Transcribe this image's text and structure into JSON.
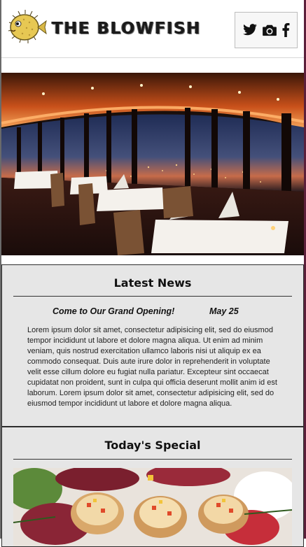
{
  "header": {
    "brand_name": "THE BLOWFISH",
    "social_icons": [
      "twitter-icon",
      "camera-icon",
      "facebook-icon"
    ]
  },
  "news": {
    "heading": "Latest News",
    "item_title": "Come to Our Grand Opening!",
    "item_date": "May 25",
    "body": "Lorem ipsum dolor sit amet, consectetur adipisicing elit, sed do eiusmod tempor incididunt ut labore et dolore magna aliqua. Ut enim ad minim veniam, quis nostrud exercitation ullamco laboris nisi ut aliquip ex ea commodo consequat. Duis aute irure dolor in reprehenderit in voluptate velit esse cillum dolore eu fugiat nulla pariatur. Excepteur sint occaecat cupidatat non proident, sunt in culpa qui officia deserunt mollit anim id est laborum. Lorem ipsum dolor sit amet, consectetur adipisicing elit, sed do eiusmod tempor incididunt ut labore et dolore magna aliqua."
  },
  "special": {
    "heading": "Today's Special"
  },
  "colors": {
    "panel_bg": "#e6e6e6",
    "panel_border": "#2d2d2d",
    "brand_text": "#1a1a1a"
  }
}
